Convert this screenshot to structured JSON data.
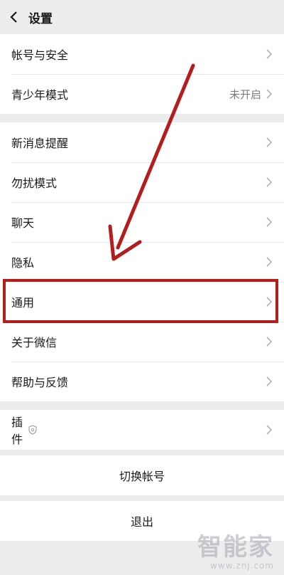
{
  "header": {
    "title": "设置"
  },
  "group1": {
    "items": [
      {
        "label": "帐号与安全",
        "value": ""
      },
      {
        "label": "青少年模式",
        "value": "未开启"
      }
    ]
  },
  "group2": {
    "items": [
      {
        "label": "新消息提醒"
      },
      {
        "label": "勿扰模式"
      },
      {
        "label": "聊天"
      },
      {
        "label": "隐私"
      },
      {
        "label": "通用"
      },
      {
        "label": "关于微信"
      },
      {
        "label": "帮助与反馈"
      }
    ]
  },
  "group3": {
    "items": [
      {
        "label": "插件"
      }
    ]
  },
  "actions": {
    "switch_account": "切换帐号",
    "logout": "退出"
  },
  "watermark": {
    "brand": "智能家",
    "url": "www.znj.com"
  },
  "colors": {
    "annotation": "#b51c1c",
    "background": "#ededed"
  },
  "icons": {
    "back": "chevron-left-icon",
    "row": "chevron-right-icon",
    "plugin": "shield-icon"
  }
}
